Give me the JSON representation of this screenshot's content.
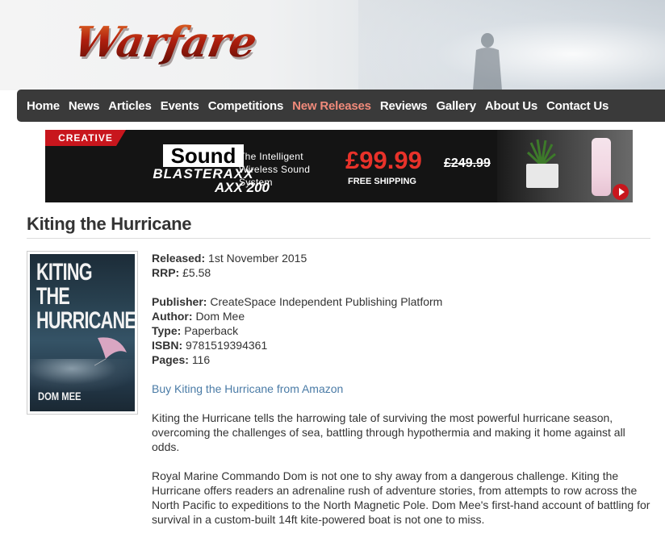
{
  "header": {
    "logo_text": "Warfare"
  },
  "nav": {
    "items": [
      {
        "label": "Home",
        "active": false
      },
      {
        "label": "News",
        "active": false
      },
      {
        "label": "Articles",
        "active": false
      },
      {
        "label": "Events",
        "active": false
      },
      {
        "label": "Competitions",
        "active": false
      },
      {
        "label": "New Releases",
        "active": true
      },
      {
        "label": "Reviews",
        "active": false
      },
      {
        "label": "Gallery",
        "active": false
      },
      {
        "label": "About Us",
        "active": false
      },
      {
        "label": "Contact Us",
        "active": false
      }
    ],
    "active_color": "#f08a7a"
  },
  "ad": {
    "brand": "CREATIVE",
    "product_line1": "Sound",
    "product_line2": "BLASTERAXX",
    "product_line3": "AXX 200",
    "tagline": "The Intelligent Wireless Sound System",
    "price": "£99.99",
    "old_price": "£249.99",
    "shipping": "FREE SHIPPING",
    "accent_color": "#e8322a"
  },
  "book": {
    "title": "Kiting the Hurricane",
    "cover_title": "KITING THE HURRICANE",
    "cover_author": "DOM MEE",
    "released_label": "Released:",
    "released": "1st November 2015",
    "rrp_label": "RRP:",
    "rrp": "£5.58",
    "publisher_label": "Publisher:",
    "publisher": "CreateSpace Independent Publishing Platform",
    "author_label": "Author:",
    "author": "Dom Mee",
    "type_label": "Type:",
    "type": "Paperback",
    "isbn_label": "ISBN:",
    "isbn": "9781519394361",
    "pages_label": "Pages:",
    "pages": "116",
    "buy_link": "Buy Kiting the Hurricane from Amazon",
    "description": [
      "Kiting the Hurricane tells the harrowing tale of surviving the most powerful hurricane season, overcoming the challenges of sea, battling through hypothermia and making it home against all odds.",
      "Royal Marine Commando Dom is not one to shy away from a dangerous challenge. Kiting the Hurricane offers readers an adrenaline rush of adventure stories, from attempts to row across the North Pacific to expeditions to the North Magnetic Pole. Dom Mee's first-hand account of battling for survival in a custom-built 14ft kite-powered boat is not one to miss."
    ],
    "link_color": "#4a7ba6"
  }
}
